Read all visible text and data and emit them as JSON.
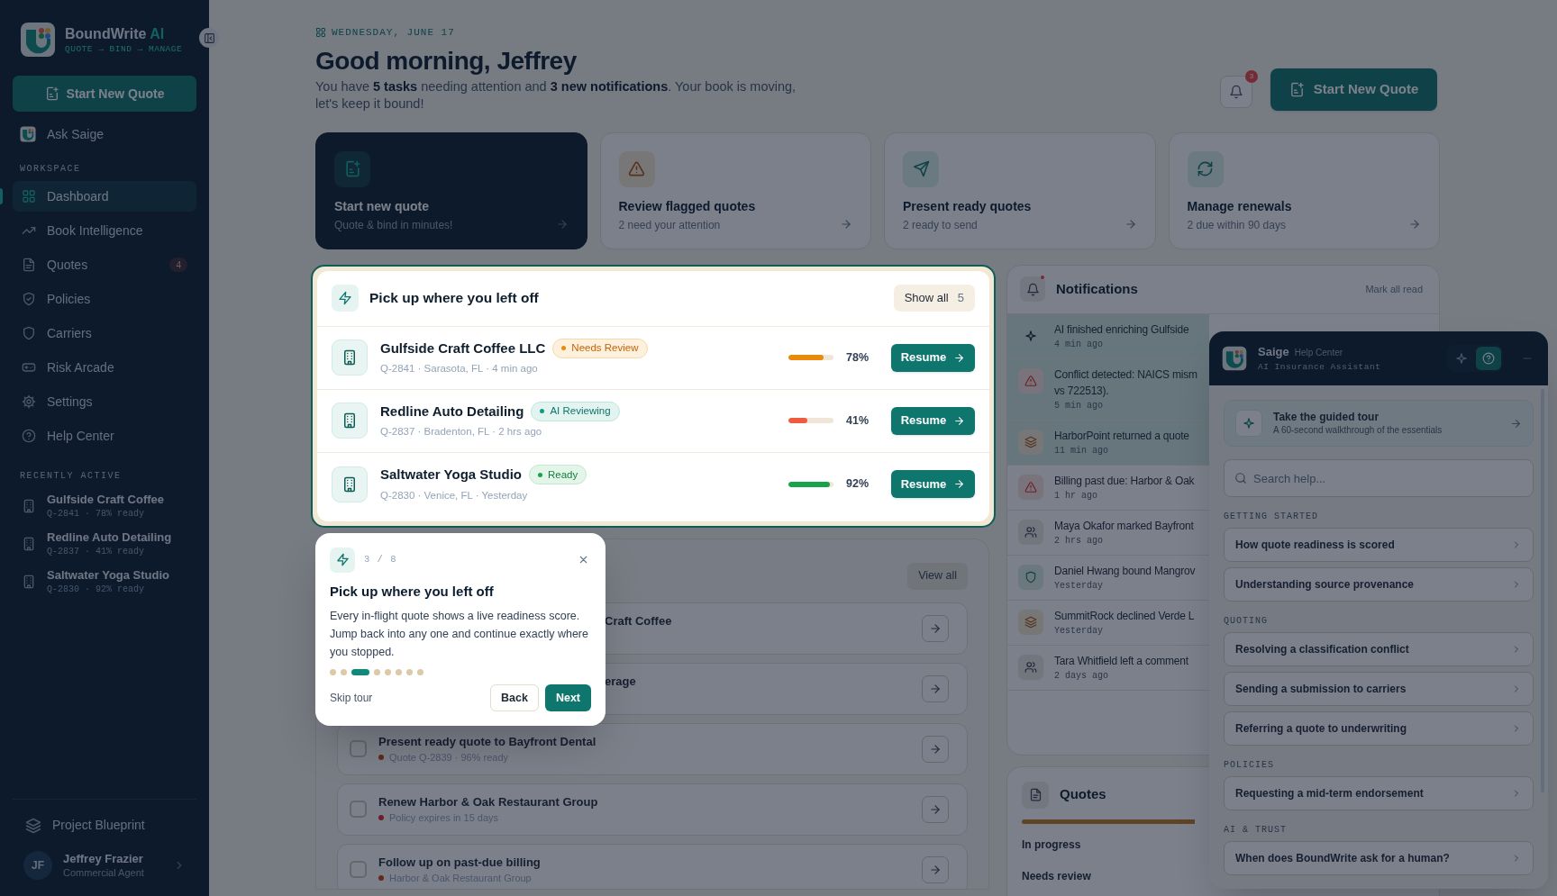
{
  "brand": {
    "name": "BoundWrite",
    "accent": "AI",
    "tagline": "QUOTE → BIND → MANAGE"
  },
  "sidebar": {
    "primary_button": "Start New Quote",
    "assistant": "Ask Saige",
    "workspace_label": "WORKSPACE",
    "items": [
      {
        "label": "Dashboard",
        "selected": true
      },
      {
        "label": "Book Intelligence",
        "selected": false
      },
      {
        "label": "Quotes",
        "selected": false,
        "badge": "4"
      },
      {
        "label": "Policies",
        "selected": false
      },
      {
        "label": "Carriers",
        "selected": false
      },
      {
        "label": "Risk Arcade",
        "selected": false
      },
      {
        "label": "Settings",
        "selected": false
      },
      {
        "label": "Help Center",
        "selected": false
      }
    ],
    "recent_label": "RECENTLY ACTIVE",
    "recent": [
      {
        "name": "Gulfside Craft Coffee",
        "meta": "Q-2841 · 78% ready"
      },
      {
        "name": "Redline Auto Detailing",
        "meta": "Q-2837 · 41% ready"
      },
      {
        "name": "Saltwater Yoga Studio",
        "meta": "Q-2830 · 92% ready"
      }
    ],
    "footer_link": "Project Blueprint",
    "user": {
      "initials": "JF",
      "name": "Jeffrey Frazier",
      "role": "Commercial Agent"
    }
  },
  "header": {
    "date": "WEDNESDAY, JUNE 17",
    "greeting": "Good morning, Jeffrey",
    "summary": "You have **5 tasks** needing attention and **3 new notifications**. Your book is moving, let's keep it bound!",
    "notification_count": "3",
    "cta": "Start New Quote"
  },
  "action_cards": [
    {
      "kind": "primary",
      "title": "Start new quote",
      "subtitle": "Quote & bind in minutes!"
    },
    {
      "kind": "warning",
      "title": "Review flagged quotes",
      "subtitle": "2 need your attention"
    },
    {
      "kind": "info",
      "title": "Present ready quotes",
      "subtitle": "2 ready to send"
    },
    {
      "kind": "info",
      "title": "Manage renewals",
      "subtitle": "2 due within 90 days"
    }
  ],
  "pickup": {
    "title": "Pick up where you left off",
    "show_all": "Show all",
    "count": "5",
    "rows": [
      {
        "name": "Gulfside Craft Coffee LLC",
        "kind": "review",
        "status": "Needs Review",
        "meta": "Q-2841 · Sarasota, FL · 4 min ago",
        "level": 0.78,
        "color": "#ea8a0c",
        "percent": "78%",
        "action": "Resume"
      },
      {
        "name": "Redline Auto Detailing",
        "kind": "ai",
        "status": "AI Reviewing",
        "meta": "Q-2837 · Bradenton, FL · 2 hrs ago",
        "level": 0.41,
        "color": "#ef5b3f",
        "percent": "41%",
        "action": "Resume"
      },
      {
        "name": "Saltwater Yoga Studio",
        "kind": "ready",
        "status": "Ready",
        "meta": "Q-2830 · Venice, FL · Yesterday",
        "level": 0.92,
        "color": "#16a34a",
        "percent": "92%",
        "action": "Resume"
      }
    ]
  },
  "tour": {
    "progress": "3 / 8",
    "title": "Pick up where you left off",
    "body": "Every in-flight quote shows a live readiness score. Jump back into any one and continue exactly where you stopped.",
    "dots": [
      {
        "selected": false
      },
      {
        "selected": false
      },
      {
        "selected": true
      },
      {
        "selected": false
      },
      {
        "selected": false
      },
      {
        "selected": false
      },
      {
        "selected": false
      },
      {
        "selected": false
      }
    ],
    "skip": "Skip tour",
    "back": "Back",
    "next": "Next"
  },
  "tasks": {
    "view_all": "View all",
    "items": [
      {
        "kind": "covered",
        "title": "Craft Coffee"
      },
      {
        "kind": "covered",
        "title": "erage"
      },
      {
        "kind": "due",
        "title": "Present ready quote to Bayfront Dental",
        "subtitle": "Quote Q-2839 · 96% ready",
        "checked": false
      },
      {
        "kind": "urgent",
        "title": "Renew Harbor & Oak Restaurant Group",
        "subtitle": "Policy expires in 15 days",
        "checked": false
      },
      {
        "kind": "due",
        "title": "Follow up on past-due billing",
        "subtitle": "Harbor & Oak Restaurant Group",
        "checked": false
      }
    ]
  },
  "notifications": {
    "title": "Notifications",
    "mark_all": "Mark all read",
    "items": [
      {
        "kind": "ai",
        "text": "AI finished enriching Gulfside",
        "time": "4 min ago",
        "unread": true
      },
      {
        "kind": "alert",
        "text": "Conflict detected: NAICS mism\nvs 722513).",
        "time": "5 min ago",
        "unread": true
      },
      {
        "kind": "carrier",
        "text": "HarborPoint returned a quote",
        "time": "11 min ago",
        "unread": true
      },
      {
        "kind": "alert",
        "text": "Billing past due: Harbor & Oak",
        "time": "1 hr ago",
        "unread": false
      },
      {
        "kind": "team",
        "text": "Maya Okafor marked Bayfront",
        "time": "2 hrs ago",
        "unread": false
      },
      {
        "kind": "bound",
        "text": "Daniel Hwang bound Mangrov",
        "time": "Yesterday",
        "unread": false
      },
      {
        "kind": "carrier",
        "text": "SummitRock declined Verde L",
        "time": "Yesterday",
        "unread": false
      },
      {
        "kind": "team",
        "text": "Tara Whitfield left a comment",
        "time": "2 days ago",
        "unread": false
      }
    ]
  },
  "quotes": {
    "title": "Quotes",
    "rows": [
      "In progress",
      "Needs review"
    ]
  },
  "saige": {
    "name": "Saige",
    "section": "Help Center",
    "subtitle": "AI Insurance Assistant",
    "modes": [
      {
        "selected": false
      },
      {
        "selected": true
      }
    ],
    "tour_card": {
      "title": "Take the guided tour",
      "subtitle": "A 60-second walkthrough of the essentials"
    },
    "search": {
      "placeholder": "Search help..."
    },
    "groups": [
      {
        "label": "GETTING STARTED",
        "articles": [
          "How quote readiness is scored",
          "Understanding source provenance"
        ]
      },
      {
        "label": "QUOTING",
        "articles": [
          "Resolving a classification conflict",
          "Sending a submission to carriers",
          "Referring a quote to underwriting"
        ]
      },
      {
        "label": "POLICIES",
        "articles": [
          "Requesting a mid-term endorsement"
        ]
      },
      {
        "label": "AI & TRUST",
        "articles": [
          "When does BoundWrite ask for a human?"
        ]
      }
    ]
  }
}
